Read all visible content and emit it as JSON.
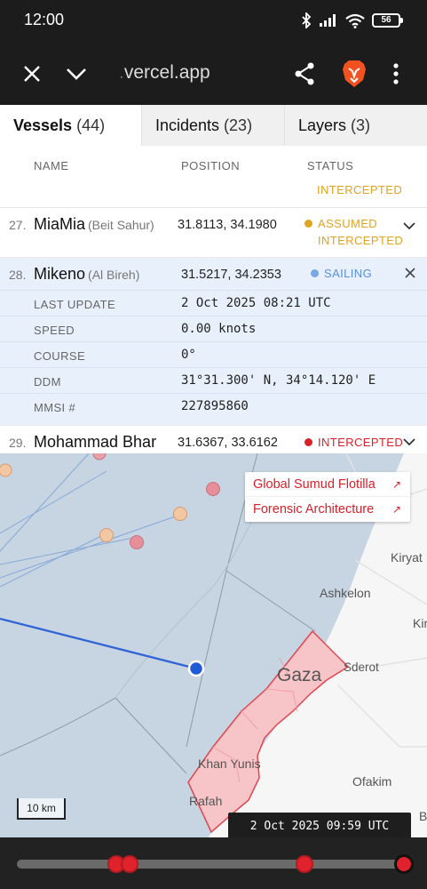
{
  "statusbar": {
    "time": "12:00",
    "battery": "56",
    "icons": [
      "bluetooth-icon",
      "signal-icon",
      "wifi-icon",
      "battery-icon"
    ]
  },
  "browser": {
    "url_prefix": ".",
    "url": "vercel.app",
    "icons": [
      "close-icon",
      "chevron-down-icon",
      "share-icon",
      "brave-lion-icon",
      "more-vert-icon"
    ]
  },
  "tabs": [
    {
      "label": "Vessels",
      "count": "(44)"
    },
    {
      "label": "Incidents",
      "count": "(23)"
    },
    {
      "label": "Layers",
      "count": "(3)"
    }
  ],
  "columns": {
    "name": "NAME",
    "position": "POSITION",
    "status": "STATUS"
  },
  "rows": {
    "partial": {
      "status_line2": "INTERCEPTED"
    },
    "r27": {
      "num": "27.",
      "name": "MiaMia",
      "sub": "(Beit Sahur)",
      "position": "31.8113, 34.1980",
      "status": "ASSUMED",
      "status2": "INTERCEPTED"
    },
    "r28": {
      "num": "28.",
      "name": "Mikeno",
      "sub": "(Al Bireh)",
      "position": "31.5217, 34.2353",
      "status": "SAILING"
    },
    "r29": {
      "num": "29.",
      "name": "Mohammad Bhar",
      "position": "31.6367, 33.6162",
      "status": "INTERCEPTED"
    }
  },
  "details": [
    {
      "label": "LAST UPDATE",
      "value": "2 Oct 2025 08:21 UTC"
    },
    {
      "label": "SPEED",
      "value": "0.00 knots"
    },
    {
      "label": "COURSE",
      "value": "0°"
    },
    {
      "label": "DDM",
      "value": "31°31.300' N, 34°14.120' E"
    },
    {
      "label": "MMSI #",
      "value": "227895860"
    }
  ],
  "map": {
    "links": [
      {
        "label": "Global Sumud Flotilla",
        "arrow": "↗"
      },
      {
        "label": "Forensic Architecture",
        "arrow": "↗"
      }
    ],
    "places": {
      "gaza": "Gaza",
      "ashkelon": "Ashkelon",
      "sderot": "Sderot",
      "khan_yunis": "Khan Yunis",
      "rafah": "Rafah",
      "ofakim": "Ofakim",
      "kiryat": "Kiryat",
      "kir": "Kir",
      "b": "B"
    },
    "scale": "10 km",
    "timestamp": "2 Oct 2025 09:59 UTC"
  },
  "colors": {
    "intercepted": "#d6212b",
    "assumed": "#e0a322",
    "sailing": "#5b8fd8",
    "sea": "#c9d7e4",
    "gaza_fill": "#f7c5c7"
  }
}
